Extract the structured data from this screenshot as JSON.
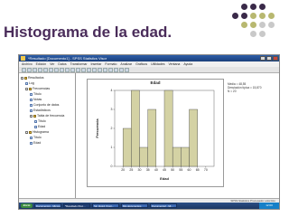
{
  "slide": {
    "title": "Histograma de la edad."
  },
  "decor_colors": {
    "dark": "#3a2a49",
    "olive": "#b8b870",
    "light": "#c9c9c9"
  },
  "window": {
    "title": "*Resultado [Documento1] - SPSS Statistics Visor",
    "menu": [
      "Archivo",
      "Edición",
      "Ver",
      "Datos",
      "Transformar",
      "Insertar",
      "Formato",
      "Analizar",
      "Gráficos",
      "Utilidades",
      "Ventana",
      "Ayuda"
    ]
  },
  "nav_tree": [
    {
      "label": "Resultados",
      "level": 0,
      "kind": "folder"
    },
    {
      "label": "Log",
      "level": 1,
      "kind": "doc"
    },
    {
      "label": "Frecuencias",
      "level": 1,
      "kind": "folder"
    },
    {
      "label": "Título",
      "level": 2,
      "kind": "doc"
    },
    {
      "label": "Notas",
      "level": 2,
      "kind": "doc"
    },
    {
      "label": "Conjunto de datos",
      "level": 2,
      "kind": "doc"
    },
    {
      "label": "Estadísticos",
      "level": 2,
      "kind": "doc"
    },
    {
      "label": "Tabla de frecuencia",
      "level": 2,
      "kind": "folder"
    },
    {
      "label": "Título",
      "level": 3,
      "kind": "doc"
    },
    {
      "label": "Edad",
      "level": 3,
      "kind": "doc"
    },
    {
      "label": "Histograma",
      "level": 1,
      "kind": "folder"
    },
    {
      "label": "Título",
      "level": 2,
      "kind": "doc"
    },
    {
      "label": "Edad",
      "level": 2,
      "kind": "doc"
    }
  ],
  "status_bar": "SPSS Statistics  Procesador está listo",
  "taskbar": {
    "start_label": "Inicio",
    "items": [
      "Documento1 - Micros...",
      "*Resultado [Doc...",
      "Sin título1 [Conj...",
      "Mis documentos",
      "Documento2 - Mi..."
    ],
    "clock": "12:00"
  },
  "stats": {
    "mean": "Media = 48,55",
    "sd": "Desviación típica = 15,870",
    "n": "N = 20"
  },
  "chart_data": {
    "type": "bar",
    "title": "Edad",
    "xlabel": "Edad",
    "ylabel": "Frecuencia",
    "categories": [
      "20",
      "25",
      "30",
      "35",
      "40",
      "45",
      "50",
      "55",
      "60",
      "65",
      "70"
    ],
    "bins": [
      {
        "start": 20,
        "end": 25,
        "count": 2
      },
      {
        "start": 25,
        "end": 30,
        "count": 4
      },
      {
        "start": 30,
        "end": 35,
        "count": 1
      },
      {
        "start": 35,
        "end": 40,
        "count": 3
      },
      {
        "start": 40,
        "end": 45,
        "count": 0
      },
      {
        "start": 45,
        "end": 50,
        "count": 4
      },
      {
        "start": 50,
        "end": 55,
        "count": 1
      },
      {
        "start": 55,
        "end": 60,
        "count": 1
      },
      {
        "start": 60,
        "end": 65,
        "count": 3
      },
      {
        "start": 65,
        "end": 70,
        "count": 0
      }
    ],
    "yticks": [
      "0",
      "1",
      "2",
      "3",
      "4"
    ],
    "ylim": [
      0,
      4
    ],
    "xlim": [
      15,
      75
    ],
    "bar_color": "#d4d2a4",
    "bar_edge": "#444444",
    "grid": false
  }
}
